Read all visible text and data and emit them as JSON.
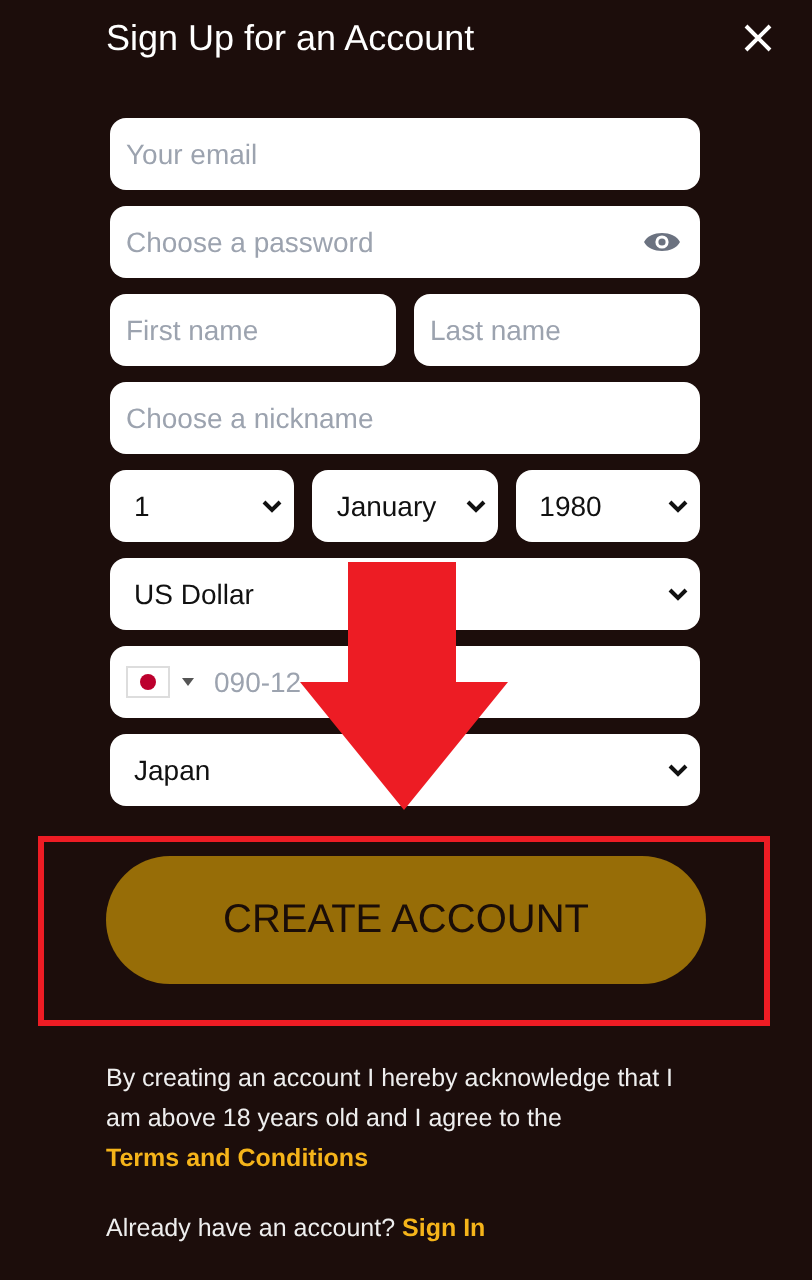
{
  "dialog": {
    "title": "Sign Up for an Account"
  },
  "rows": [
    {
      "fields": [
        {
          "kind": "input",
          "placeholder": "Your email"
        }
      ]
    },
    {
      "fields": [
        {
          "kind": "password",
          "placeholder": "Choose a password"
        }
      ]
    },
    {
      "fields": [
        {
          "kind": "input",
          "placeholder": "First name"
        },
        {
          "kind": "input",
          "placeholder": "Last name"
        }
      ]
    },
    {
      "fields": [
        {
          "kind": "input",
          "placeholder": "Choose a nickname"
        }
      ]
    },
    {
      "fields": [
        {
          "kind": "select",
          "value": "1"
        },
        {
          "kind": "select",
          "value": "January"
        },
        {
          "kind": "select",
          "value": "1980"
        }
      ]
    },
    {
      "fields": [
        {
          "kind": "select",
          "value": "US Dollar"
        }
      ]
    },
    {
      "fields": [
        {
          "kind": "phone",
          "placeholder": "090-12"
        }
      ]
    },
    {
      "fields": [
        {
          "kind": "select",
          "value": "Japan"
        }
      ]
    }
  ],
  "submit": {
    "label": "CREATE ACCOUNT"
  },
  "disclaimer": {
    "text": "By creating an account I hereby acknowledge that I am above 18 years old and I agree to the",
    "link": "Terms and Conditions"
  },
  "signin": {
    "text": "Already have an account?",
    "link": "Sign In"
  }
}
